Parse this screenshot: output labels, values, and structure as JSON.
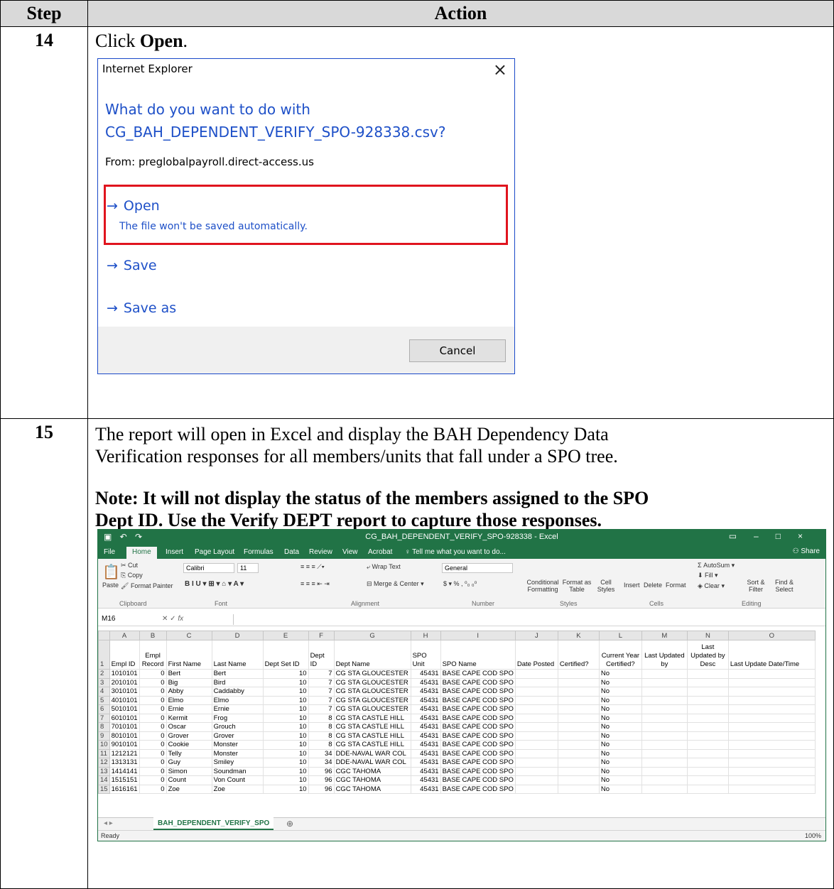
{
  "table": {
    "header_step": "Step",
    "header_action": "Action"
  },
  "step14": {
    "number": "14",
    "instruction_prefix": "Click ",
    "instruction_bold": "Open",
    "instruction_suffix": ".",
    "dialog": {
      "title": "Internet Explorer",
      "close_glyph": "×",
      "question_line1": "What do you want to do with",
      "question_line2": "CG_BAH_DEPENDENT_VERIFY_SPO-928338.csv?",
      "from": "From: preglobalpayroll.direct-access.us",
      "arrow": "→",
      "open_label": "Open",
      "open_sub": "The file won't be saved automatically.",
      "save_label": "Save",
      "save_as_label": "Save as",
      "cancel_label": "Cancel"
    }
  },
  "step15": {
    "number": "15",
    "text_line1": "The report will open in Excel and display the BAH Dependency Data",
    "text_line2": "Verification responses for all members/units that fall under a SPO tree.",
    "note_line1": "Note: It will not display the status of the members assigned to the SPO",
    "note_line2": "Dept ID. Use the Verify DEPT report to capture those responses."
  },
  "excel": {
    "window_title": "CG_BAH_DEPENDENT_VERIFY_SPO-928338 - Excel",
    "tabs": [
      "File",
      "Home",
      "Insert",
      "Page Layout",
      "Formulas",
      "Data",
      "Review",
      "View",
      "Acrobat"
    ],
    "tell_me": "Tell me what you want to do...",
    "share": "Share",
    "ribbon": {
      "cut": "Cut",
      "copy": "Copy",
      "paste": "Paste",
      "format_painter": "Format Painter",
      "clipboard": "Clipboard",
      "font_name": "Calibri",
      "font_size": "11",
      "font": "Font",
      "wrap_text": "Wrap Text",
      "merge_center": "Merge & Center",
      "alignment": "Alignment",
      "number_format": "General",
      "number": "Number",
      "conditional_formatting": "Conditional Formatting",
      "format_as_table": "Format as Table",
      "cell_styles": "Cell Styles",
      "styles": "Styles",
      "insert": "Insert",
      "delete": "Delete",
      "format": "Format",
      "cells": "Cells",
      "autosum": "AutoSum",
      "fill": "Fill",
      "clear": "Clear",
      "sort_filter": "Sort & Filter",
      "find_select": "Find & Select",
      "editing": "Editing"
    },
    "name_box": "M16",
    "fx": "fx",
    "columns": [
      "A",
      "B",
      "C",
      "D",
      "E",
      "F",
      "G",
      "H",
      "I",
      "J",
      "K",
      "L",
      "M",
      "N",
      "O"
    ],
    "headers": [
      "Empl ID",
      "Empl Record",
      "First Name",
      "Last Name",
      "Dept Set ID",
      "Dept ID",
      "Dept Name",
      "SPO Unit",
      "SPO Name",
      "Date Posted",
      "Certified?",
      "Current Year Certified?",
      "Last Updated by",
      "Last Updated by Desc",
      "Last Update Date/Time"
    ],
    "rows": [
      [
        "2",
        "1010101",
        "0",
        "Bert",
        "Bert",
        "10",
        "7",
        "CG STA GLOUCESTER",
        "45431",
        "BASE CAPE COD SPO",
        "",
        "",
        "No",
        "",
        "",
        ""
      ],
      [
        "3",
        "2010101",
        "0",
        "Big",
        "Bird",
        "10",
        "7",
        "CG STA GLOUCESTER",
        "45431",
        "BASE CAPE COD SPO",
        "",
        "",
        "No",
        "",
        "",
        ""
      ],
      [
        "4",
        "3010101",
        "0",
        "Abby",
        "Caddabby",
        "10",
        "7",
        "CG STA GLOUCESTER",
        "45431",
        "BASE CAPE COD SPO",
        "",
        "",
        "No",
        "",
        "",
        ""
      ],
      [
        "5",
        "4010101",
        "0",
        "Elmo",
        "Elmo",
        "10",
        "7",
        "CG STA GLOUCESTER",
        "45431",
        "BASE CAPE COD SPO",
        "",
        "",
        "No",
        "",
        "",
        ""
      ],
      [
        "6",
        "5010101",
        "0",
        "Ernie",
        "Ernie",
        "10",
        "7",
        "CG STA GLOUCESTER",
        "45431",
        "BASE CAPE COD SPO",
        "",
        "",
        "No",
        "",
        "",
        ""
      ],
      [
        "7",
        "6010101",
        "0",
        "Kermit",
        "Frog",
        "10",
        "8",
        "CG STA CASTLE HILL",
        "45431",
        "BASE CAPE COD SPO",
        "",
        "",
        "No",
        "",
        "",
        ""
      ],
      [
        "8",
        "7010101",
        "0",
        "Oscar",
        "Grouch",
        "10",
        "8",
        "CG STA CASTLE HILL",
        "45431",
        "BASE CAPE COD SPO",
        "",
        "",
        "No",
        "",
        "",
        ""
      ],
      [
        "9",
        "8010101",
        "0",
        "Grover",
        "Grover",
        "10",
        "8",
        "CG STA CASTLE HILL",
        "45431",
        "BASE CAPE COD SPO",
        "",
        "",
        "No",
        "",
        "",
        ""
      ],
      [
        "10",
        "9010101",
        "0",
        "Cookie",
        "Monster",
        "10",
        "8",
        "CG STA CASTLE HILL",
        "45431",
        "BASE CAPE COD SPO",
        "",
        "",
        "No",
        "",
        "",
        ""
      ],
      [
        "11",
        "1212121",
        "0",
        "Telly",
        "Monster",
        "10",
        "34",
        "DDE-NAVAL WAR COL",
        "45431",
        "BASE CAPE COD SPO",
        "",
        "",
        "No",
        "",
        "",
        ""
      ],
      [
        "12",
        "1313131",
        "0",
        "Guy",
        "Smiley",
        "10",
        "34",
        "DDE-NAVAL WAR COL",
        "45431",
        "BASE CAPE COD SPO",
        "",
        "",
        "No",
        "",
        "",
        ""
      ],
      [
        "13",
        "1414141",
        "0",
        "Simon",
        "Soundman",
        "10",
        "96",
        "CGC TAHOMA",
        "45431",
        "BASE CAPE COD SPO",
        "",
        "",
        "No",
        "",
        "",
        ""
      ],
      [
        "14",
        "1515151",
        "0",
        "Count",
        "Von Count",
        "10",
        "96",
        "CGC TAHOMA",
        "45431",
        "BASE CAPE COD SPO",
        "",
        "",
        "No",
        "",
        "",
        ""
      ],
      [
        "15",
        "1616161",
        "0",
        "Zoe",
        "Zoe",
        "10",
        "96",
        "CGC TAHOMA",
        "45431",
        "BASE CAPE COD SPO",
        "",
        "",
        "No",
        "",
        "",
        ""
      ]
    ],
    "sheet_tab": "BAH_DEPENDENT_VERIFY_SPO",
    "add_sheet": "⊕",
    "status": "Ready",
    "zoom": "100%"
  }
}
